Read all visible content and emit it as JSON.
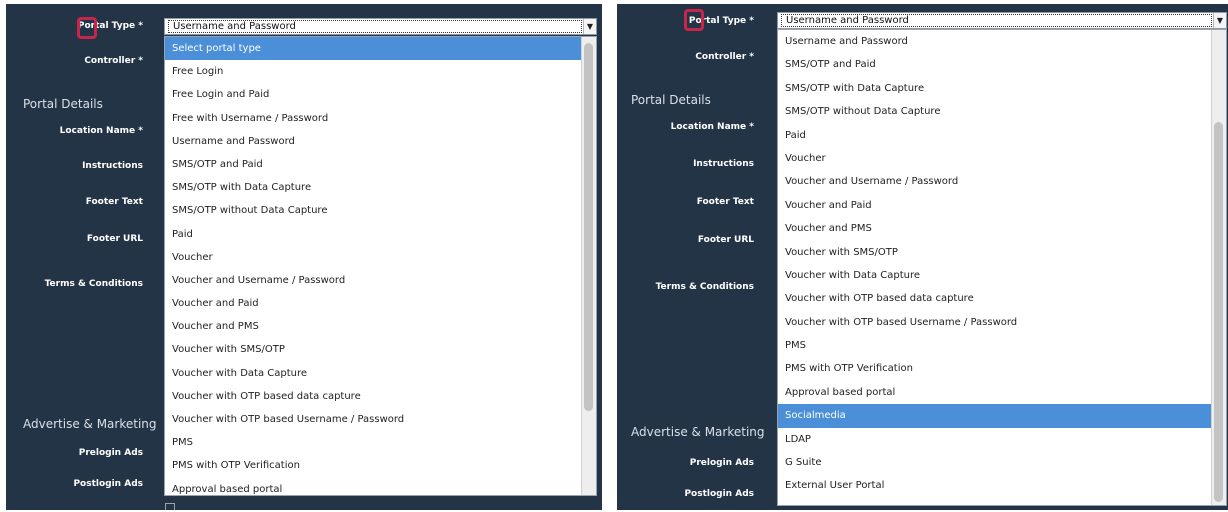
{
  "left": {
    "portal_type_label": "Portal Type *",
    "controller_label": "Controller *",
    "portal_details_heading": "Portal Details",
    "location_name_label": "Location Name *",
    "instructions_label": "Instructions",
    "footer_text_label": "Footer Text",
    "footer_url_label": "Footer URL",
    "terms_label": "Terms & Conditions",
    "advertise_heading": "Advertise & Marketing",
    "prelogin_label": "Prelogin Ads",
    "postlogin_label": "Postlogin Ads",
    "select_value": "Username and Password",
    "options": [
      {
        "label": "Select portal type",
        "selected": true
      },
      {
        "label": "Free Login"
      },
      {
        "label": "Free Login and Paid"
      },
      {
        "label": "Free with Username / Password"
      },
      {
        "label": "Username and Password"
      },
      {
        "label": "SMS/OTP and Paid"
      },
      {
        "label": "SMS/OTP with Data Capture"
      },
      {
        "label": "SMS/OTP without Data Capture"
      },
      {
        "label": "Paid"
      },
      {
        "label": "Voucher"
      },
      {
        "label": "Voucher and Username / Password"
      },
      {
        "label": "Voucher and Paid"
      },
      {
        "label": "Voucher and PMS"
      },
      {
        "label": "Voucher with SMS/OTP"
      },
      {
        "label": "Voucher with Data Capture"
      },
      {
        "label": "Voucher with OTP based data capture"
      },
      {
        "label": "Voucher with OTP based Username / Password"
      },
      {
        "label": "PMS"
      },
      {
        "label": "PMS with OTP Verification"
      },
      {
        "label": "Approval based portal"
      }
    ]
  },
  "right": {
    "portal_type_label": "Portal Type *",
    "controller_label": "Controller *",
    "portal_details_heading": "Portal Details",
    "location_name_label": "Location Name *",
    "instructions_label": "Instructions",
    "footer_text_label": "Footer Text",
    "footer_url_label": "Footer URL",
    "terms_label": "Terms & Conditions",
    "advertise_heading": "Advertise & Marketing",
    "prelogin_label": "Prelogin Ads",
    "postlogin_label": "Postlogin Ads",
    "select_value": "Username and Password",
    "options": [
      {
        "label": "Username and Password"
      },
      {
        "label": "SMS/OTP and Paid"
      },
      {
        "label": "SMS/OTP with Data Capture"
      },
      {
        "label": "SMS/OTP without Data Capture"
      },
      {
        "label": "Paid"
      },
      {
        "label": "Voucher"
      },
      {
        "label": "Voucher and Username / Password"
      },
      {
        "label": "Voucher and Paid"
      },
      {
        "label": "Voucher and PMS"
      },
      {
        "label": "Voucher with SMS/OTP"
      },
      {
        "label": "Voucher with Data Capture"
      },
      {
        "label": "Voucher with OTP based data capture"
      },
      {
        "label": "Voucher with OTP based Username / Password"
      },
      {
        "label": "PMS"
      },
      {
        "label": "PMS with OTP Verification"
      },
      {
        "label": "Approval based portal"
      },
      {
        "label": "Socialmedia",
        "selected": true
      },
      {
        "label": "LDAP"
      },
      {
        "label": "G Suite"
      },
      {
        "label": "External User Portal"
      }
    ]
  },
  "colors": {
    "panel_bg": "#243447",
    "selected_option": "#4a8fd8",
    "highlight_box": "#c8254b"
  },
  "icons": {
    "select_arrow": "caret-down-icon"
  }
}
